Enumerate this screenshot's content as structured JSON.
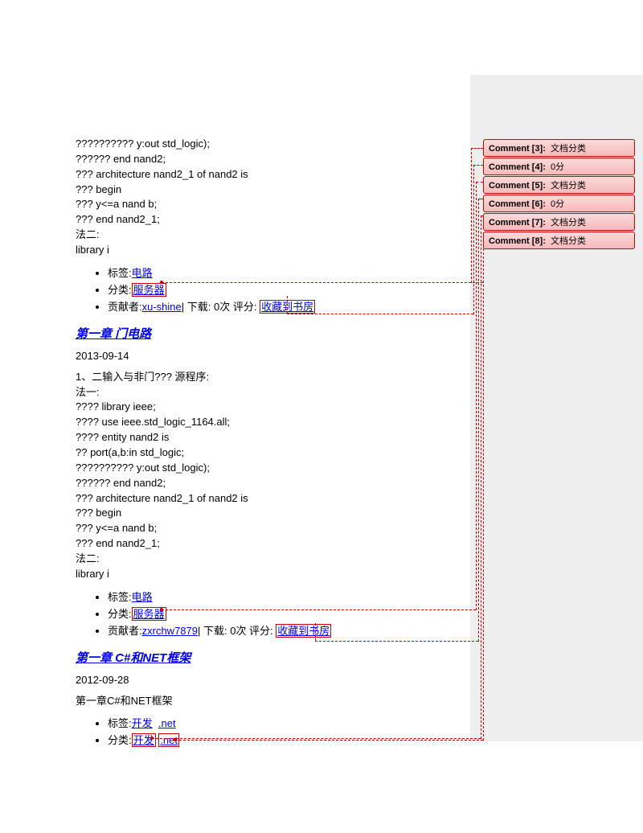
{
  "code1": {
    "l1": "?????????? y:out std_logic);",
    "l2": "?????? end nand2;",
    "l3": "??? architecture nand2_1 of nand2 is",
    "l4": "??? begin",
    "l5": "??? y<=a nand b;",
    "l6": "??? end nand2_1;",
    "l7": "法二:",
    "l8": "library i"
  },
  "meta1": {
    "tag_label": "标签:",
    "tag_val": "电路",
    "cat_label": "分类:",
    "cat_val": "服务器",
    "contrib_label": "贡献者:",
    "contrib_user": "xu-shine",
    "dl": "| 下载: 0次 评分:",
    "fav": "收藏到书房"
  },
  "heading1": "第一章 门电路",
  "date1": "2013-09-14",
  "intro2": "1、二输入与非门??? 源程序:",
  "code2": {
    "l0": "法一:",
    "l1": "???? library ieee;",
    "l2": "???? use ieee.std_logic_1164.all;",
    "l3": "???? entity nand2 is",
    "l4": "?? port(a,b:in std_logic;",
    "l5": "?????????? y:out std_logic);",
    "l6": "?????? end nand2;",
    "l7": "??? architecture nand2_1 of nand2 is",
    "l8": "??? begin",
    "l9": "??? y<=a nand b;",
    "l10": "??? end nand2_1;",
    "l11": "法二:",
    "l12": "library i"
  },
  "meta2": {
    "tag_label": "标签:",
    "tag_val": "电路",
    "cat_label": "分类:",
    "cat_val": "服务器",
    "contrib_label": "贡献者:",
    "contrib_user": "zxrchw7879",
    "dl": "| 下载: 0次 评分:",
    "fav": "收藏到书房"
  },
  "heading2": "第一章 C#和NET框架",
  "date2": "2012-09-28",
  "intro3": "第一章C#和NET框架",
  "meta3": {
    "tag_label": "标签:",
    "tag_val1": "开发",
    "tag_val2": ".net",
    "cat_label": "分类:",
    "cat_val1": "开发",
    "cat_val2": ".net"
  },
  "comments": {
    "c3": {
      "label": "Comment [3]:",
      "text": "文档分类"
    },
    "c4": {
      "label": "Comment [4]:",
      "text": "0分"
    },
    "c5": {
      "label": "Comment [5]:",
      "text": "文档分类"
    },
    "c6": {
      "label": "Comment [6]:",
      "text": "0分"
    },
    "c7": {
      "label": "Comment [7]:",
      "text": "文档分类"
    },
    "c8": {
      "label": "Comment [8]:",
      "text": "文档分类"
    }
  }
}
